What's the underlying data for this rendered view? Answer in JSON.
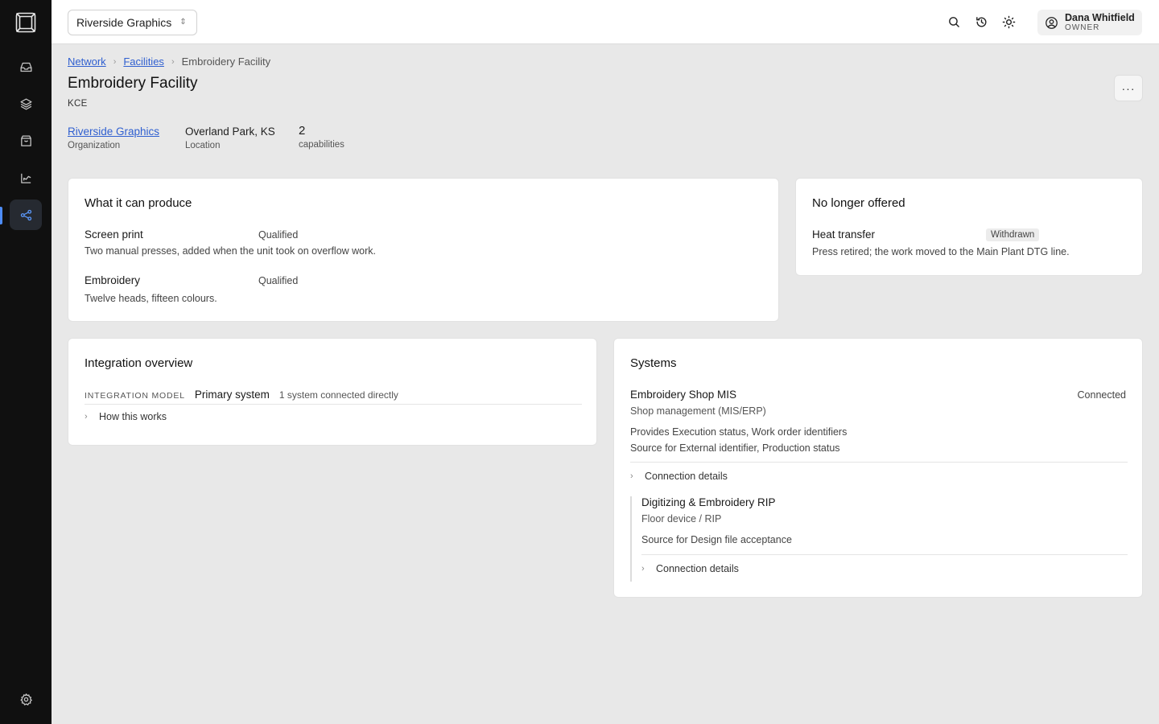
{
  "header": {
    "org_selector": "Riverside Graphics",
    "user": {
      "name": "Dana Whitfield",
      "role": "OWNER"
    }
  },
  "breadcrumb": [
    "Network",
    "Facilities",
    "Embroidery Facility"
  ],
  "page": {
    "title": "Embroidery Facility",
    "code": "KCE"
  },
  "meta": {
    "organization": {
      "value": "Riverside Graphics",
      "label": "Organization"
    },
    "location": {
      "value": "Overland Park, KS",
      "label": "Location"
    },
    "capabilities": {
      "value": "2",
      "label": "capabilities"
    }
  },
  "produce": {
    "title": "What it can produce",
    "items": [
      {
        "name": "Screen print",
        "status": "Qualified",
        "desc": "Two manual presses, added when the unit took on overflow work."
      },
      {
        "name": "Embroidery",
        "status": "Qualified",
        "desc": "Twelve heads, fifteen colours."
      }
    ]
  },
  "no_longer": {
    "title": "No longer offered",
    "items": [
      {
        "name": "Heat transfer",
        "status": "Withdrawn",
        "desc": "Press retired; the work moved to the Main Plant DTG line."
      }
    ]
  },
  "integration": {
    "title": "Integration overview",
    "label": "INTEGRATION MODEL",
    "model": "Primary system",
    "note": "1 system connected directly",
    "how": "How this works"
  },
  "systems": {
    "title": "Systems",
    "primary": {
      "name": "Embroidery Shop MIS",
      "type": "Shop management (MIS/ERP)",
      "status": "Connected",
      "provides": "Provides Execution status, Work order identifiers",
      "source": "Source for External identifier, Production status",
      "details": "Connection details"
    },
    "secondary": {
      "name": "Digitizing & Embroidery RIP",
      "type": "Floor device / RIP",
      "source": "Source for Design file acceptance",
      "details": "Connection details"
    }
  },
  "colors": {
    "accent": "#4d8cf7",
    "link": "#2f5fd0",
    "sidebar": "#101010"
  }
}
